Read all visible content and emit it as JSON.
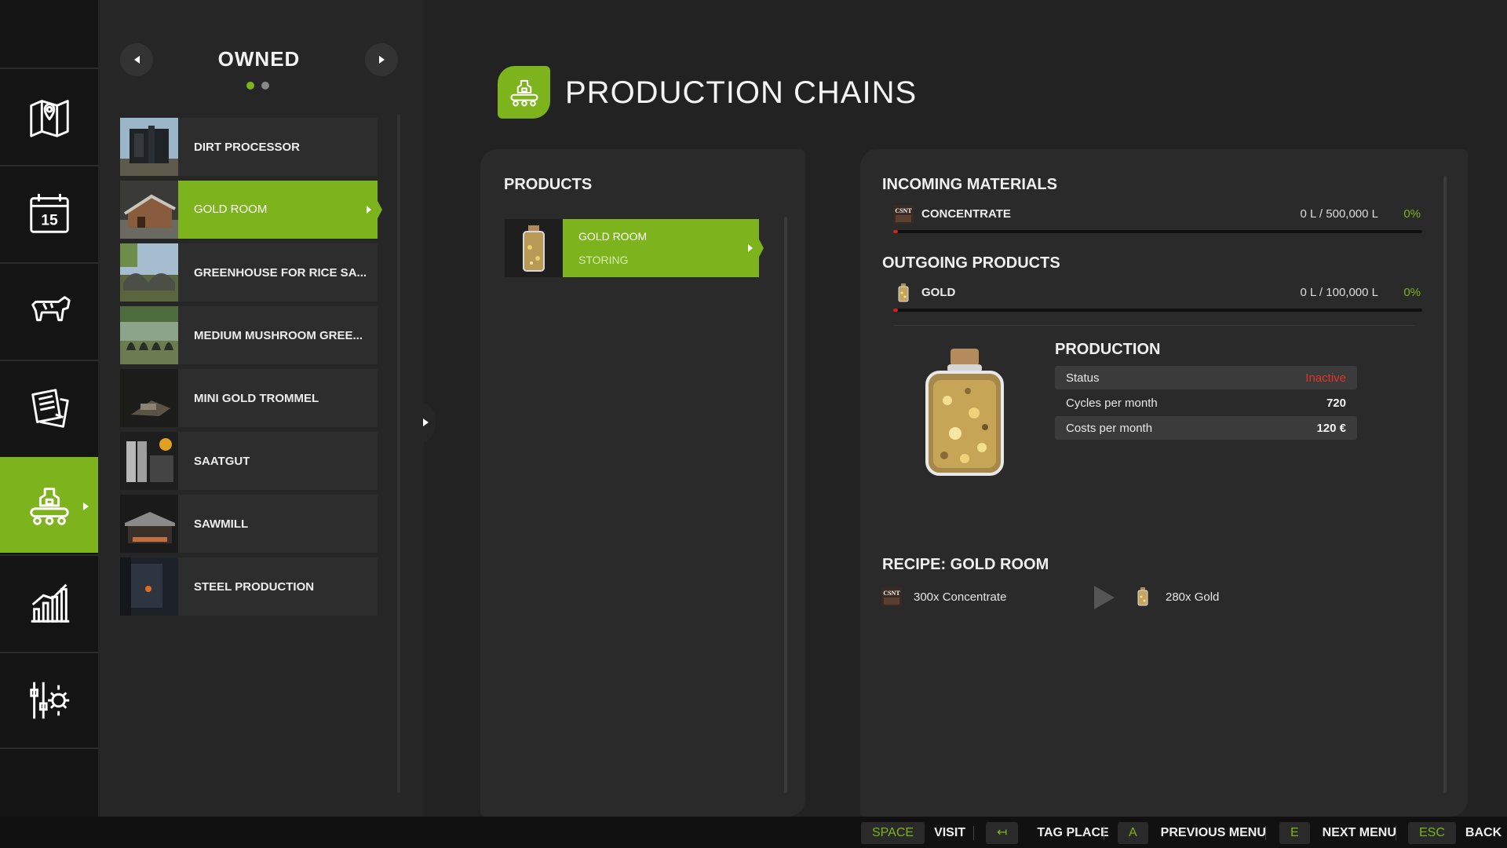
{
  "sidebar": {
    "items": [
      {
        "icon": "map-icon"
      },
      {
        "icon": "calendar-icon",
        "label": "15"
      },
      {
        "icon": "cow-icon"
      },
      {
        "icon": "contracts-icon"
      },
      {
        "icon": "production-icon",
        "active": true
      },
      {
        "icon": "statistics-icon"
      },
      {
        "icon": "settings-icon"
      }
    ]
  },
  "owned": {
    "title": "OWNED",
    "page_count": 2,
    "current_page": 1,
    "items": [
      {
        "label": "DIRT PROCESSOR"
      },
      {
        "label": "GOLD ROOM",
        "selected": true
      },
      {
        "label": "GREENHOUSE FOR RICE SA..."
      },
      {
        "label": "MEDIUM MUSHROOM GREE..."
      },
      {
        "label": "MINI GOLD TROMMEL"
      },
      {
        "label": "SAATGUT"
      },
      {
        "label": "SAWMILL"
      },
      {
        "label": "STEEL PRODUCTION"
      }
    ]
  },
  "header": {
    "title": "PRODUCTION CHAINS"
  },
  "products": {
    "title": "PRODUCTS",
    "items": [
      {
        "name": "GOLD ROOM",
        "status": "STORING"
      }
    ]
  },
  "details": {
    "incoming_title": "INCOMING MATERIALS",
    "incoming": [
      {
        "icon_text": "CSNT",
        "name": "CONCENTRATE",
        "amount": "0 L / 500,000 L",
        "percent": "0%",
        "fill": 0
      }
    ],
    "outgoing_title": "OUTGOING PRODUCTS",
    "outgoing": [
      {
        "name": "GOLD",
        "amount": "0 L / 100,000 L",
        "percent": "0%",
        "fill": 0
      }
    ],
    "production": {
      "title": "PRODUCTION",
      "status_label": "Status",
      "status_value": "Inactive",
      "cycles_label": "Cycles per month",
      "cycles_value": "720",
      "costs_label": "Costs per month",
      "costs_value": "120 €"
    },
    "recipe": {
      "title": "RECIPE: GOLD ROOM",
      "input_icon_text": "CSNT",
      "input": "300x Concentrate",
      "output": "280x Gold"
    }
  },
  "bottom_bar": {
    "hints": [
      {
        "key": "SPACE",
        "action": "VISIT"
      },
      {
        "key": "↤",
        "action": "TAG PLACE"
      },
      {
        "key": "A",
        "action": "PREVIOUS MENU"
      },
      {
        "key": "E",
        "action": "NEXT MENU"
      },
      {
        "key": "ESC",
        "action": "BACK"
      }
    ]
  },
  "colors": {
    "accent": "#7db31c",
    "inactive": "#e0332a",
    "background": "#222222"
  }
}
